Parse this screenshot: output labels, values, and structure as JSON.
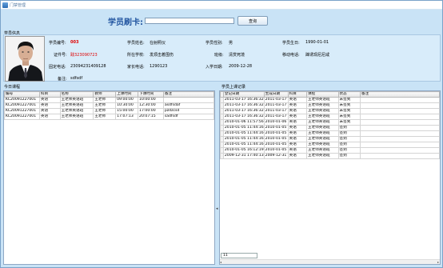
{
  "window": {
    "title": "门禁管理"
  },
  "swipe": {
    "label": "学员刷卡:",
    "card_value": "",
    "query_label": "查询"
  },
  "student_info": {
    "section_label": "学员信息",
    "id_label": "学员编号:",
    "id_value": "003",
    "name_label": "学员姓名:",
    "name_value": "在射照仪",
    "gender_label": "学员性别:",
    "gender_value": "男",
    "birthday_label": "学员生日:",
    "birthday_value": "1990-01-01",
    "idcard_label": "证件号:",
    "idcard_value": "践323090723",
    "school_label": "所在学校:",
    "school_value": "发烦击着围伤",
    "class_label": "班级:",
    "class_value": "清赏死境",
    "mobile_label": "移动电话:",
    "mobile_value": "蹿诱现尼尼咸",
    "phone_label": "固定电话:",
    "phone_value": "23094231409128",
    "parent_phone_label": "家长电话:",
    "parent_phone_value": "1290123",
    "enroll_label": "入学日期:",
    "enroll_value": "2009-12-28",
    "remark_label": "备注:",
    "remark_value": "sdfsdf"
  },
  "today_courses": {
    "section_label": "今日课程",
    "columns": [
      "编号",
      "科目",
      "名称",
      "教师",
      "上课时间",
      "下课时间",
      "备注"
    ],
    "rows": [
      [
        "KC20091227001",
        "英语",
        "王老师英语班",
        "王老师",
        "09:00:00",
        "10:00:00",
        ""
      ],
      [
        "KC20091227001",
        "英语",
        "王老师英语班",
        "王老师",
        "10:30:00",
        "12:30:00",
        "asdfsdaf"
      ],
      [
        "KC20091227001",
        "英语",
        "王老师英语班",
        "王老师",
        "15:00:00",
        "17:00:00",
        "pzdzcsd"
      ],
      [
        "KC20091227001",
        "英语",
        "王老师英语班",
        "王老师",
        "17:07:13",
        "20:07:15",
        "sadfsdf"
      ]
    ]
  },
  "attendance": {
    "section_label": "学员上课记录",
    "columns": [
      "登记日期",
      "生成日期",
      "科目",
      "课程",
      "状态",
      "备注"
    ],
    "rows": [
      [
        "2011-03-17 16:36:32",
        "2011-03-17",
        "英语",
        "王老师英语班",
        "未签到",
        ""
      ],
      [
        "2011-03-17 16:36:32",
        "2011-03-17",
        "英语",
        "王老师英语班",
        "未签到",
        ""
      ],
      [
        "2011-03-17 16:36:32",
        "2011-03-17",
        "英语",
        "王老师英语班",
        "未签到",
        ""
      ],
      [
        "2011-03-17 16:36:32",
        "2011-03-17",
        "英语",
        "王老师英语班",
        "未签到",
        ""
      ],
      [
        "2010-01-06 11:57:56",
        "2010-01-06",
        "英语",
        "王老师英语班",
        "未签到",
        ""
      ],
      [
        "2010-01-05 11:44:16",
        "2010-01-05",
        "英语",
        "王老师英语班",
        "签到",
        ""
      ],
      [
        "2010-01-05 11:44:16",
        "2010-01-05",
        "英语",
        "王老师英语班",
        "签到",
        ""
      ],
      [
        "2010-01-05 11:44:16",
        "2010-01-05",
        "英语",
        "王老师英语班",
        "签到",
        ""
      ],
      [
        "2010-01-05 11:44:16",
        "2010-01-05",
        "英语",
        "王老师英语班",
        "签到",
        ""
      ],
      [
        "2010-01-05 16:12:19",
        "2010-01-05",
        "英语",
        "王老师英语班",
        "签到",
        ""
      ],
      [
        "2009-12-31 17:40:13",
        "2009-12-31",
        "英语",
        "王老师英语班",
        "签到",
        ""
      ]
    ],
    "page_value": "11"
  },
  "icons": {
    "app": "app-icon",
    "splitter": "collapse-arrow-icon",
    "scroll_left": "scroll-left-icon",
    "scroll_right": "scroll-right-icon"
  }
}
